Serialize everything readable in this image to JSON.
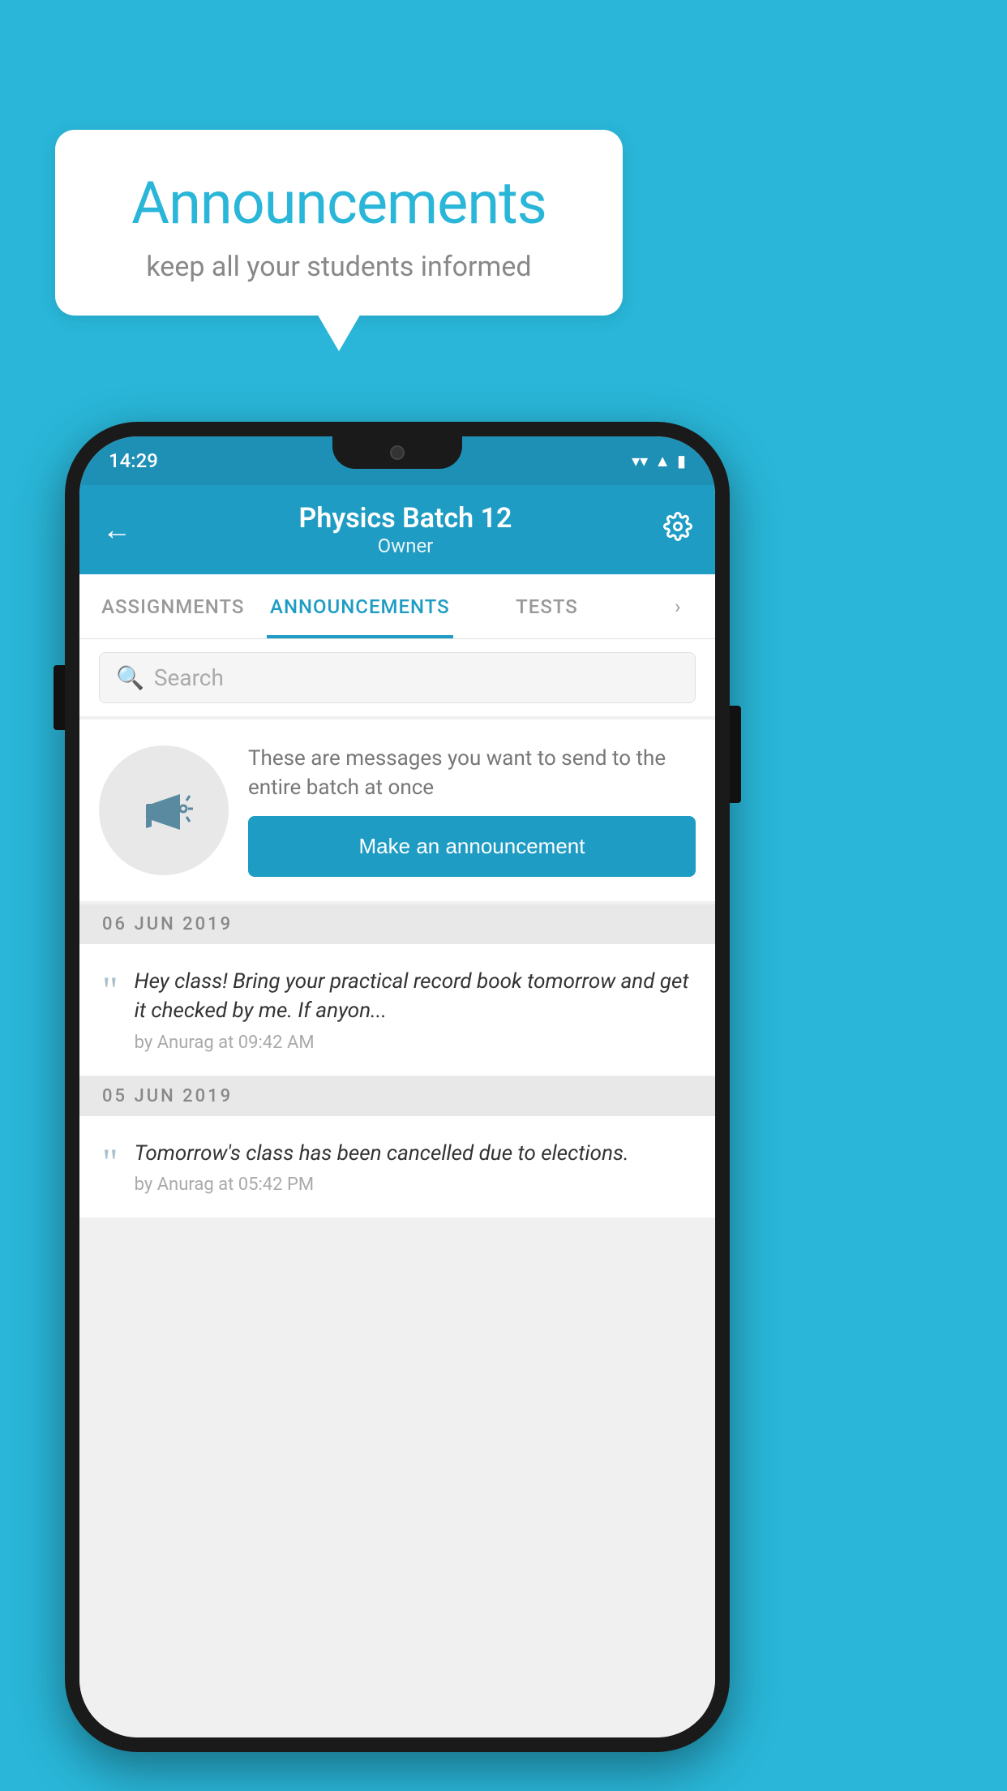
{
  "background": {
    "color": "#29b6d8"
  },
  "speech_bubble": {
    "title": "Announcements",
    "subtitle": "keep all your students informed"
  },
  "phone": {
    "status_bar": {
      "time": "14:29",
      "wifi_icon": "wifi",
      "signal_icon": "signal",
      "battery_icon": "battery"
    },
    "app_bar": {
      "back_label": "←",
      "title": "Physics Batch 12",
      "subtitle": "Owner",
      "settings_icon": "gear"
    },
    "tabs": [
      {
        "label": "ASSIGNMENTS",
        "active": false
      },
      {
        "label": "ANNOUNCEMENTS",
        "active": true
      },
      {
        "label": "TESTS",
        "active": false
      }
    ],
    "search": {
      "placeholder": "Search"
    },
    "promo": {
      "description": "These are messages you want to send to the entire batch at once",
      "button_label": "Make an announcement"
    },
    "announcements": [
      {
        "date": "06  JUN  2019",
        "items": [
          {
            "text": "Hey class! Bring your practical record book tomorrow and get it checked by me. If anyon...",
            "meta": "by Anurag at 09:42 AM"
          }
        ]
      },
      {
        "date": "05  JUN  2019",
        "items": [
          {
            "text": "Tomorrow's class has been cancelled due to elections.",
            "meta": "by Anurag at 05:42 PM"
          }
        ]
      }
    ]
  }
}
